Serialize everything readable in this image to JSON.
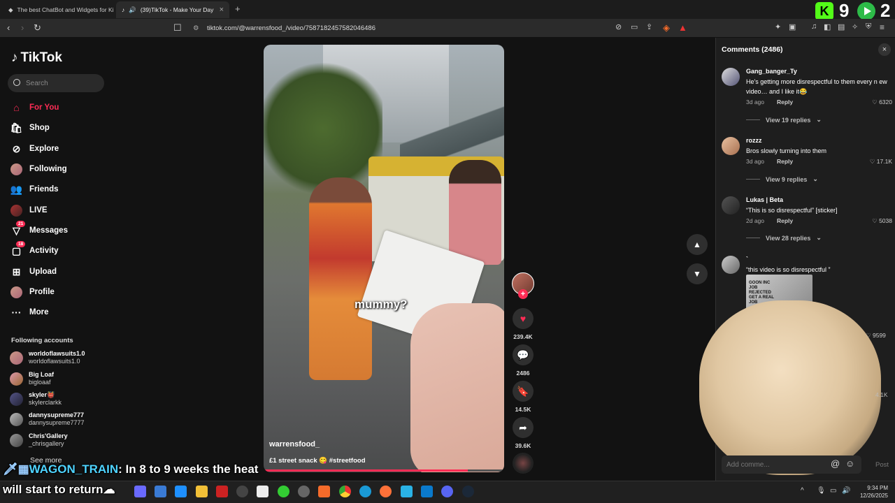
{
  "browser": {
    "tabs": [
      {
        "title": "The best ChatBot and Widgets for Ki",
        "active": false
      },
      {
        "title": "(39)TikTok - Make Your Day",
        "active": true,
        "audio": true
      }
    ],
    "url": "tiktok.com/@warrensfood_/video/7587182457582046486"
  },
  "overlay_widget": {
    "kick_count": "9",
    "play_count": "2",
    "brand_color": "#53fc18"
  },
  "tiktok": {
    "logo": "TikTok",
    "search_placeholder": "Search",
    "nav": [
      {
        "label": "For You",
        "icon": "home-icon",
        "active": true
      },
      {
        "label": "Shop",
        "icon": "shop-icon"
      },
      {
        "label": "Explore",
        "icon": "compass-icon"
      },
      {
        "label": "Following",
        "icon": "following-avatar"
      },
      {
        "label": "Friends",
        "icon": "friends-icon"
      },
      {
        "label": "LIVE",
        "icon": "live-avatar"
      },
      {
        "label": "Messages",
        "icon": "messages-icon",
        "badge": "21"
      },
      {
        "label": "Activity",
        "icon": "activity-icon",
        "badge": "18"
      },
      {
        "label": "Upload",
        "icon": "upload-icon"
      },
      {
        "label": "Profile",
        "icon": "profile-avatar"
      },
      {
        "label": "More",
        "icon": "more-icon"
      }
    ],
    "following_title": "Following accounts",
    "following_accounts": [
      {
        "name": "worldoflawsuits1.0",
        "handle": "worldoflawsuits1.0"
      },
      {
        "name": "Big Loaf",
        "handle": "bigloaaf"
      },
      {
        "name": "skyler👹",
        "handle": "skylerclarkk"
      },
      {
        "name": "dannysupreme777",
        "handle": "dannysupreme7777"
      },
      {
        "name": "Chris'Gallery",
        "handle": "_chrisgallery"
      }
    ],
    "see_more": "See more",
    "accent": "#fe2c55"
  },
  "video": {
    "caption_word": "mummy?",
    "author": "warrensfood_",
    "description": "£1 street snack 😋 #streetfood",
    "likes": "239.4K",
    "comments": "2486",
    "saves": "14.5K",
    "shares": "39.6K",
    "progress": 0.85
  },
  "comments_panel": {
    "title": "Comments (2486)",
    "close": "×",
    "items": [
      {
        "user": "Gang_banger_Ty",
        "text": "He's getting more disrespectful to them every n ew video… and I like it😂",
        "age": "3d ago",
        "reply": "Reply",
        "likes": "6320",
        "view_replies": "View 19 replies"
      },
      {
        "user": "rozzz",
        "text": "Bros slowly turning into them",
        "age": "3d ago",
        "reply": "Reply",
        "likes": "17.1K",
        "view_replies": "View 9 replies"
      },
      {
        "user": "Lukas | Beta",
        "text": "“This is so disrespectful” [sticker]",
        "age": "2d ago",
        "reply": "Reply",
        "likes": "5038",
        "view_replies": "View 28 replies"
      },
      {
        "user": "`",
        "text": "“this video is so disrespectful ”",
        "likes": "9599"
      }
    ],
    "sticker_text": "GOON INC JOB REJECTED GET A REAL JOB",
    "partial_likes": "4.1K",
    "add_comment_placeholder": "Add comme...",
    "post": "Post"
  },
  "chat_overlay": {
    "name": "WAGON_TRAIN",
    "line1": ": In 8 to 9 weeks the heat",
    "line2": "will start to return"
  },
  "taskbar": {
    "time": "9:34 PM",
    "date": "12/26/2025"
  }
}
